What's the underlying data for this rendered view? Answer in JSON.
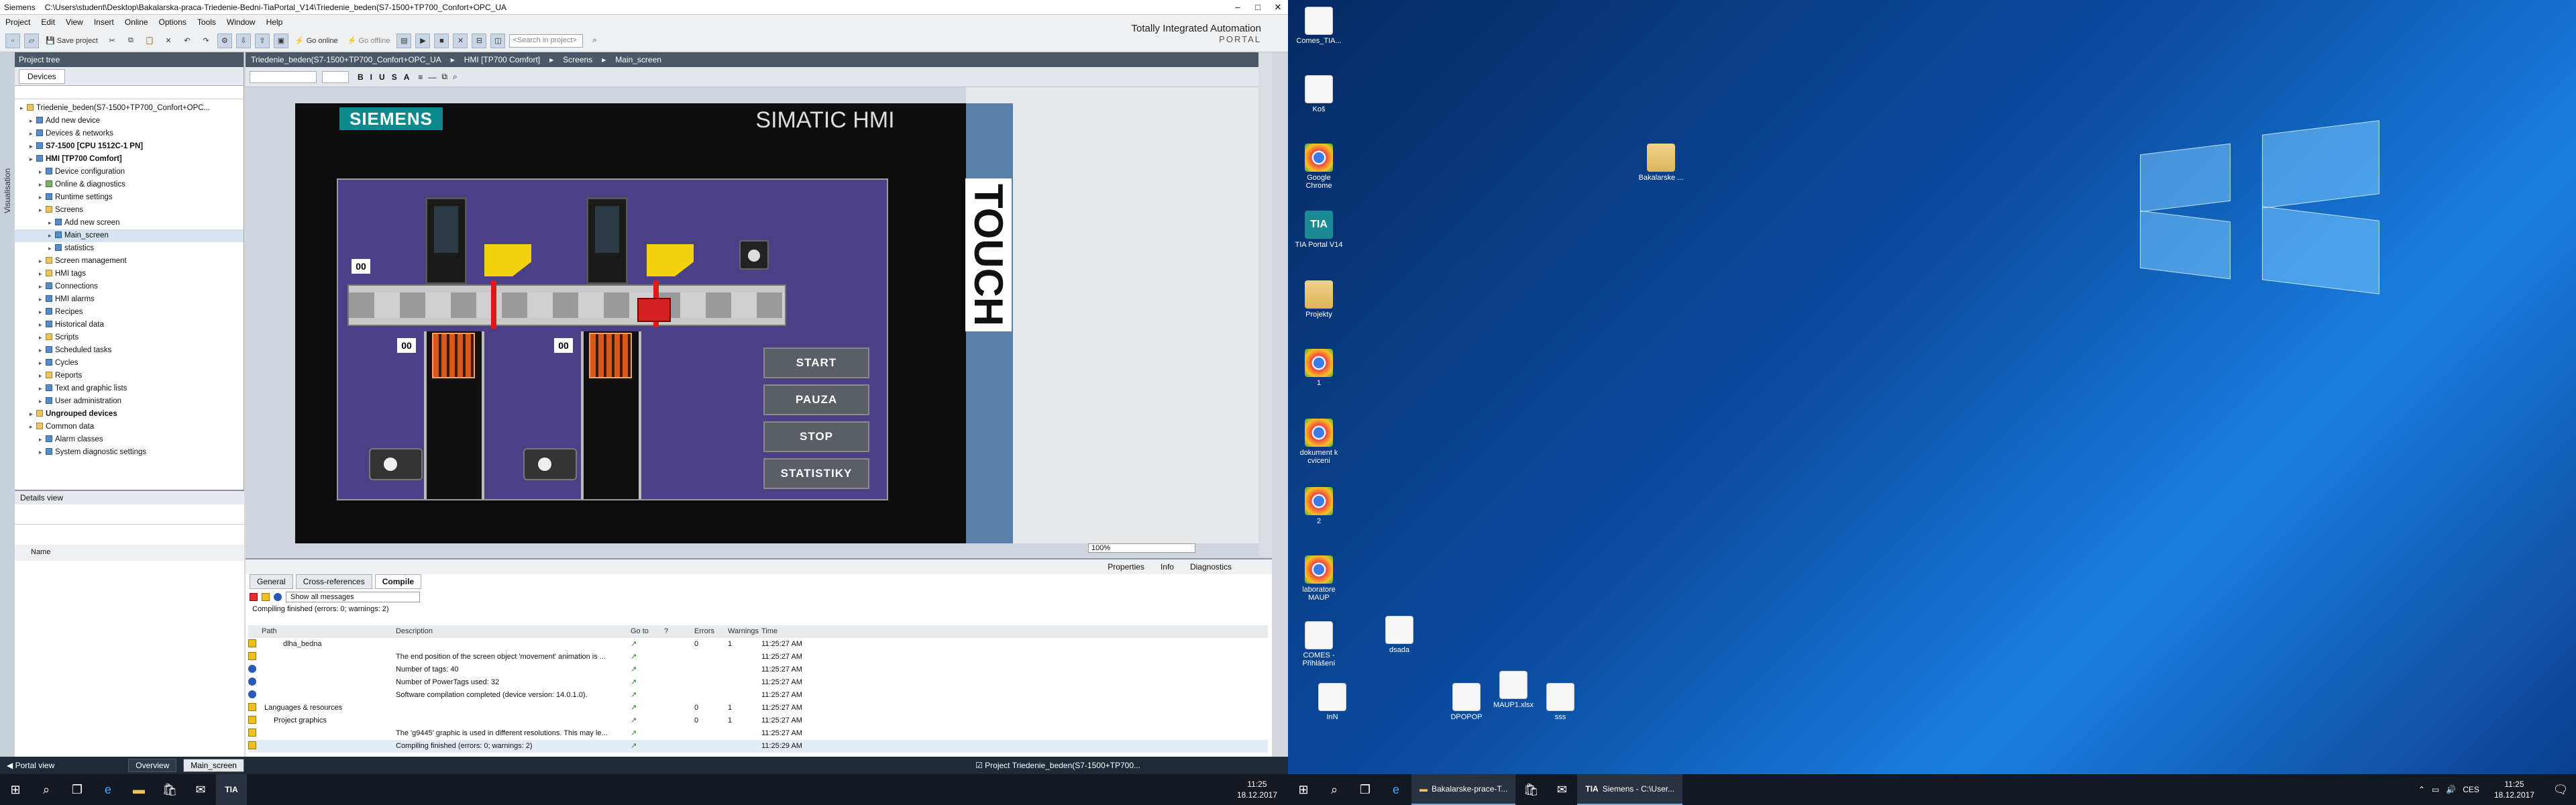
{
  "title_bar": {
    "app": "Siemens",
    "path": "C:\\Users\\student\\Desktop\\Bakalarska-praca-Triedenie-Bedni-TiaPortal_V14\\Triedenie_beden(S7-1500+TP700_Confort+OPC_UA"
  },
  "menu": [
    "Project",
    "Edit",
    "View",
    "Insert",
    "Online",
    "Options",
    "Tools",
    "Window",
    "Help"
  ],
  "toolbar": {
    "save": "Save project",
    "go_online": "Go online",
    "go_offline": "Go offline",
    "search_placeholder": "<Search in project>"
  },
  "brand": {
    "line1": "Totally Integrated Automation",
    "line2": "PORTAL"
  },
  "project_tree": {
    "header": "Project tree",
    "devices_tab": "Devices",
    "side_tab": "Visualisation",
    "items": [
      {
        "label": "Triedenie_beden(S7-1500+TP700_Confort+OPC...",
        "level": 0,
        "icon": "y"
      },
      {
        "label": "Add new device",
        "level": 1,
        "icon": "b"
      },
      {
        "label": "Devices & networks",
        "level": 1,
        "icon": "b"
      },
      {
        "label": "S7-1500 [CPU 1512C-1 PN]",
        "level": 1,
        "icon": "b",
        "bold": true
      },
      {
        "label": "HMI [TP700 Comfort]",
        "level": 1,
        "icon": "b",
        "bold": true
      },
      {
        "label": "Device configuration",
        "level": 2,
        "icon": "b"
      },
      {
        "label": "Online & diagnostics",
        "level": 2,
        "icon": "g"
      },
      {
        "label": "Runtime settings",
        "level": 2,
        "icon": "b"
      },
      {
        "label": "Screens",
        "level": 2,
        "icon": "y"
      },
      {
        "label": "Add new screen",
        "level": 3,
        "icon": "b"
      },
      {
        "label": "Main_screen",
        "level": 3,
        "icon": "b",
        "selected": true
      },
      {
        "label": "statistics",
        "level": 3,
        "icon": "b"
      },
      {
        "label": "Screen management",
        "level": 2,
        "icon": "y"
      },
      {
        "label": "HMI tags",
        "level": 2,
        "icon": "y"
      },
      {
        "label": "Connections",
        "level": 2,
        "icon": "b"
      },
      {
        "label": "HMI alarms",
        "level": 2,
        "icon": "b"
      },
      {
        "label": "Recipes",
        "level": 2,
        "icon": "b"
      },
      {
        "label": "Historical data",
        "level": 2,
        "icon": "b"
      },
      {
        "label": "Scripts",
        "level": 2,
        "icon": "y"
      },
      {
        "label": "Scheduled tasks",
        "level": 2,
        "icon": "b"
      },
      {
        "label": "Cycles",
        "level": 2,
        "icon": "b"
      },
      {
        "label": "Reports",
        "level": 2,
        "icon": "y"
      },
      {
        "label": "Text and graphic lists",
        "level": 2,
        "icon": "b"
      },
      {
        "label": "User administration",
        "level": 2,
        "icon": "b"
      },
      {
        "label": "Ungrouped devices",
        "level": 1,
        "icon": "y",
        "bold": true
      },
      {
        "label": "Common data",
        "level": 1,
        "icon": "y"
      },
      {
        "label": "Alarm classes",
        "level": 2,
        "icon": "b"
      },
      {
        "label": "System diagnostic settings",
        "level": 2,
        "icon": "b"
      }
    ]
  },
  "details_view": {
    "header": "Details view",
    "col_name": "Name"
  },
  "editor": {
    "breadcrumb": [
      "Triedenie_beden(S7-1500+TP700_Confort+OPC_UA",
      "HMI [TP700 Comfort]",
      "Screens",
      "Main_screen"
    ],
    "format_buttons": [
      "B",
      "I",
      "U",
      "S",
      "A"
    ],
    "zoom": "100%"
  },
  "hmi": {
    "siemens": "SIEMENS",
    "simatic": "SIMATIC HMI",
    "touch": "TOUCH",
    "counters": [
      "00",
      "00",
      "00"
    ],
    "buttons": [
      "START",
      "PAUZA",
      "STOP",
      "STATISTIKY"
    ]
  },
  "bottom_panel": {
    "right_tabs": [
      "Properties",
      "Info",
      "Diagnostics"
    ],
    "tabs": [
      "General",
      "Cross-references",
      "Compile"
    ],
    "filter": "Show all messages",
    "summary": "Compiling finished (errors: 0; warnings: 2)",
    "columns": [
      "",
      "Path",
      "Description",
      "Go to",
      "?",
      "Errors",
      "Warnings",
      "Time"
    ],
    "rows": [
      {
        "type": "w",
        "path": "dlha_bedna",
        "indent": 2,
        "desc": "",
        "errors": "0",
        "warnings": "1",
        "time": "11:25:27 AM"
      },
      {
        "type": "w",
        "path": "",
        "indent": 0,
        "desc": "The end position of the screen object 'movement' animation is ...",
        "errors": "",
        "warnings": "",
        "time": "11:25:27 AM"
      },
      {
        "type": "i",
        "path": "",
        "indent": 0,
        "desc": "Number of tags: 40",
        "errors": "",
        "warnings": "",
        "time": "11:25:27 AM"
      },
      {
        "type": "i",
        "path": "",
        "indent": 0,
        "desc": "Number of PowerTags used: 32",
        "errors": "",
        "warnings": "",
        "time": "11:25:27 AM"
      },
      {
        "type": "i",
        "path": "",
        "indent": 0,
        "desc": "Software compilation completed (device version: 14.0.1.0).",
        "errors": "",
        "warnings": "",
        "time": "11:25:27 AM"
      },
      {
        "type": "w",
        "path": "Languages & resources",
        "indent": 0,
        "desc": "",
        "errors": "0",
        "warnings": "1",
        "time": "11:25:27 AM"
      },
      {
        "type": "w",
        "path": "Project graphics",
        "indent": 1,
        "desc": "",
        "errors": "0",
        "warnings": "1",
        "time": "11:25:27 AM"
      },
      {
        "type": "w",
        "path": "",
        "indent": 0,
        "desc": "The 'g9445' graphic is used in different resolutions. This may le...",
        "errors": "",
        "warnings": "",
        "time": "11:25:27 AM"
      },
      {
        "type": "w",
        "path": "",
        "indent": 0,
        "desc": "Compiling finished (errors: 0; warnings: 2)",
        "errors": "",
        "warnings": "",
        "time": "11:25:29 AM"
      }
    ]
  },
  "portal_bar": {
    "portal_view": "Portal view",
    "tabs": [
      "Overview",
      "Main_screen"
    ],
    "status": "Project Triedenie_beden(S7-1500+TP700..."
  },
  "taskbar_left": {
    "time": "11:25",
    "date": "18.12.2017"
  },
  "taskbar_right": {
    "apps": [
      "Bakalarske-prace-T...",
      "Siemens - C:\\User..."
    ],
    "lang": "CES",
    "time": "11:25",
    "date": "18.12.2017"
  },
  "desktop_icons": [
    {
      "label": "Comes_TIA...",
      "kind": "doc"
    },
    {
      "label": "Koš",
      "kind": "doc"
    },
    {
      "label": "Google Chrome",
      "kind": "chrome"
    },
    {
      "label": "TIA Portal V14",
      "kind": "tia"
    },
    {
      "label": "Projekty",
      "kind": "folder"
    },
    {
      "label": "1",
      "kind": "chrome"
    },
    {
      "label": "dokument k cviceni",
      "kind": "chrome"
    },
    {
      "label": "2",
      "kind": "chrome"
    },
    {
      "label": "laboratore MAUP",
      "kind": "chrome"
    },
    {
      "label": "COMES - Přihlášení",
      "kind": "doc"
    },
    {
      "label": "InN",
      "kind": "doc"
    },
    {
      "label": "dsada",
      "kind": "doc"
    },
    {
      "label": "DPOPOP",
      "kind": "doc"
    },
    {
      "label": "MAUP1.xlsx",
      "kind": "doc"
    },
    {
      "label": "sss",
      "kind": "doc"
    },
    {
      "label": "Bakalarske ...",
      "kind": "folder"
    }
  ],
  "colors": {
    "hmi_bg": "#4b3f86",
    "siemens": "#0a8a8c",
    "panel_header": "#4a5868"
  }
}
